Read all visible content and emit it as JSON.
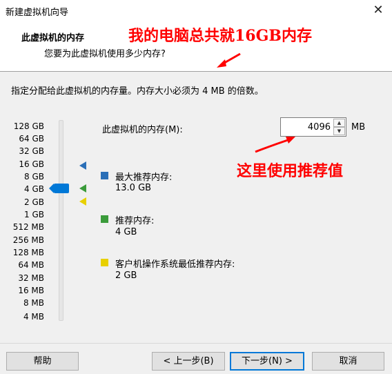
{
  "window": {
    "title": "新建虚拟机向导",
    "close_icon": "close-icon"
  },
  "header": {
    "title": "此虚拟机的内存",
    "subtitle": "您要为此虚拟机使用多少内存?"
  },
  "annotations": {
    "top_note": "我的电脑总共就16GB内存",
    "side_note": "这里使用推荐值",
    "color": "#ff0000"
  },
  "instruction": "指定分配给此虚拟机的内存量。内存大小必须为 4 MB 的倍数。",
  "scale_labels": [
    "128 GB",
    "64 GB",
    "32 GB",
    "16 GB",
    "8 GB",
    "4 GB",
    "2 GB",
    "1 GB",
    "512 MB",
    "256 MB",
    "128 MB",
    "64 MB",
    "32 MB",
    "16 MB",
    "8 MB",
    "4 MB"
  ],
  "slider": {
    "selected": "4 GB",
    "accent": "#0078d7"
  },
  "memory": {
    "label": "此虚拟机的内存(M):",
    "value": "4096",
    "unit": "MB"
  },
  "legend": [
    {
      "title": "最大推荐内存:",
      "value": "13.0 GB",
      "color": "#2a6fb7"
    },
    {
      "title": "推荐内存:",
      "value": "4 GB",
      "color": "#3a9b3a"
    },
    {
      "title": "客户机操作系统最低推荐内存:",
      "value": "2 GB",
      "color": "#e8d000"
    }
  ],
  "buttons": {
    "help": "帮助",
    "back": "< 上一步(B)",
    "next": "下一步(N) >",
    "cancel": "取消"
  }
}
